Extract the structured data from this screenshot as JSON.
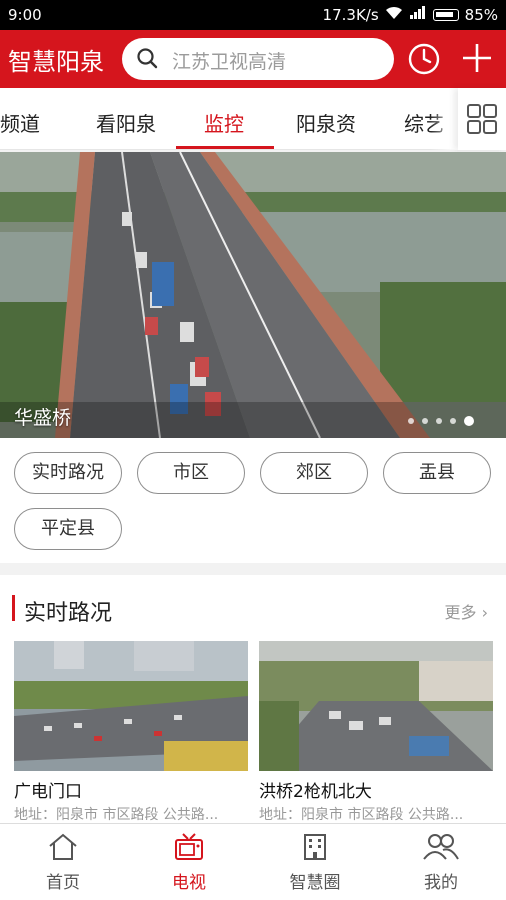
{
  "status_bar": {
    "time": "9:00",
    "network_speed": "17.3K/s",
    "battery": "85%"
  },
  "header": {
    "app_title": "智慧阳泉",
    "search_placeholder": "江苏卫视高清"
  },
  "tabs": [
    {
      "label": "频道"
    },
    {
      "label": "看阳泉"
    },
    {
      "label": "监控"
    },
    {
      "label": "阳泉资"
    },
    {
      "label": "综艺"
    }
  ],
  "active_tab": "监控",
  "banner": {
    "caption": "华盛桥",
    "slide_count": 5,
    "active_slide": 5
  },
  "filter_chips": [
    "实时路况",
    "市区",
    "郊区",
    "盂县",
    "平定县"
  ],
  "section": {
    "title": "实时路况",
    "more_label": "更多",
    "cards": [
      {
        "name": "广电门口",
        "address": "地址：阳泉市 市区路段 公共路..."
      },
      {
        "name": "洪桥2枪机北大",
        "address": "地址：阳泉市 市区路段 公共路..."
      }
    ]
  },
  "bottom_nav": [
    {
      "label": "首页",
      "icon": "home-icon"
    },
    {
      "label": "电视",
      "icon": "tv-icon"
    },
    {
      "label": "智慧圈",
      "icon": "building-icon"
    },
    {
      "label": "我的",
      "icon": "people-icon"
    }
  ],
  "active_nav": "电视",
  "colors": {
    "brand_red": "#d5151d"
  }
}
